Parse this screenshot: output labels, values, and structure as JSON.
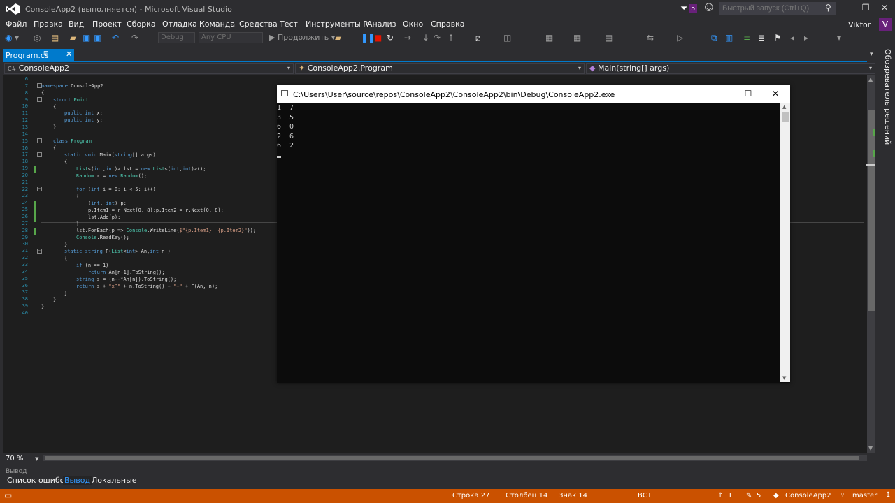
{
  "window": {
    "title": "ConsoleApp2 (выполняется) - Microsoft Visual Studio",
    "notification_count": "5",
    "quick_launch_placeholder": "Быстрый запуск (Ctrl+Q)"
  },
  "menu": {
    "items": [
      "Файл",
      "Правка",
      "Вид",
      "Проект",
      "Сборка",
      "Отладка",
      "Команда",
      "Средства",
      "Тест",
      "Инструменты R",
      "Анализ",
      "Окно",
      "Справка"
    ]
  },
  "user": {
    "name": "Viktor",
    "initial": "V"
  },
  "toolbar": {
    "config": "Debug",
    "platform": "Any CPU",
    "continue_label": "Продолжить"
  },
  "tabs": {
    "active": "Program.cs"
  },
  "nav": {
    "project": "ConsoleApp2",
    "class": "ConsoleApp2.Program",
    "member": "Main(string[] args)"
  },
  "editor": {
    "line_numbers": [
      "6",
      "7",
      "8",
      "9",
      "10",
      "11",
      "12",
      "13",
      "14",
      "15",
      "16",
      "17",
      "18",
      "19",
      "20",
      "21",
      "22",
      "23",
      "24",
      "25",
      "26",
      "27",
      "28",
      "29",
      "30",
      "31",
      "32",
      "33",
      "34",
      "35",
      "36",
      "37",
      "38",
      "39",
      "40"
    ],
    "zoom": "70 %"
  },
  "console": {
    "title": "C:\\Users\\User\\source\\repos\\ConsoleApp2\\ConsoleApp2\\bin\\Debug\\ConsoleApp2.exe",
    "output": "1  7\n3  5\n6  0\n2  6\n6  2"
  },
  "side_panel": {
    "label": "Обозреватель решений"
  },
  "output_pane": {
    "title": "Вывод"
  },
  "bottom_tabs": [
    "Список ошибок",
    "Вывод",
    "Локальные"
  ],
  "status": {
    "row": "Строка 27",
    "col": "Столбец 14",
    "char": "Знак 14",
    "mode": "ВСТ",
    "up_count": "1",
    "edits": "5",
    "repo": "ConsoleApp2",
    "branch": "master"
  },
  "colors": {
    "accent": "#007acc",
    "status_bar": "#ca5100",
    "badge": "#68217a"
  }
}
